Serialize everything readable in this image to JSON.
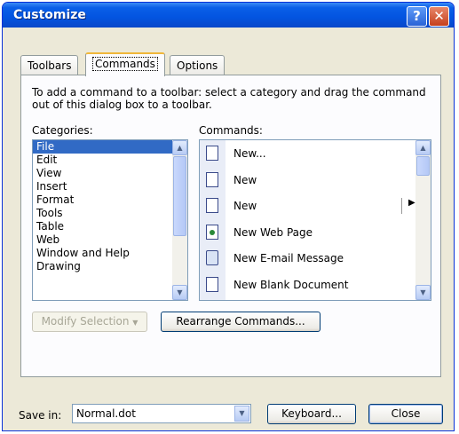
{
  "window": {
    "title": "Customize"
  },
  "tabs": [
    {
      "label": "Toolbars",
      "active": false
    },
    {
      "label": "Commands",
      "active": true
    },
    {
      "label": "Options",
      "active": false
    }
  ],
  "instructions": "To add a command to a toolbar: select a category and drag the command out of this dialog box to a toolbar.",
  "categories": {
    "label": "Categories:",
    "items": [
      "File",
      "Edit",
      "View",
      "Insert",
      "Format",
      "Tools",
      "Table",
      "Web",
      "Window and Help",
      "Drawing"
    ],
    "selected": "File"
  },
  "commands": {
    "label": "Commands:",
    "items": [
      {
        "label": "New...",
        "icon": "blank-document-icon"
      },
      {
        "label": "New",
        "icon": "blank-document-icon"
      },
      {
        "label": "New",
        "icon": "blank-document-icon",
        "submenu": true
      },
      {
        "label": "New Web Page",
        "icon": "web-page-icon"
      },
      {
        "label": "New E-mail Message",
        "icon": "email-message-icon"
      },
      {
        "label": "New Blank Document",
        "icon": "blank-document-icon"
      }
    ]
  },
  "buttons": {
    "modify_selection": "Modify Selection",
    "rearrange_commands": "Rearrange Commands...",
    "keyboard": "Keyboard...",
    "close": "Close"
  },
  "footer": {
    "save_in_label": "Save in:",
    "save_in_value": "Normal.dot"
  },
  "colors": {
    "titlebar": "#0354e0",
    "dialog_bg": "#ece9d8",
    "selection": "#316ac5"
  }
}
